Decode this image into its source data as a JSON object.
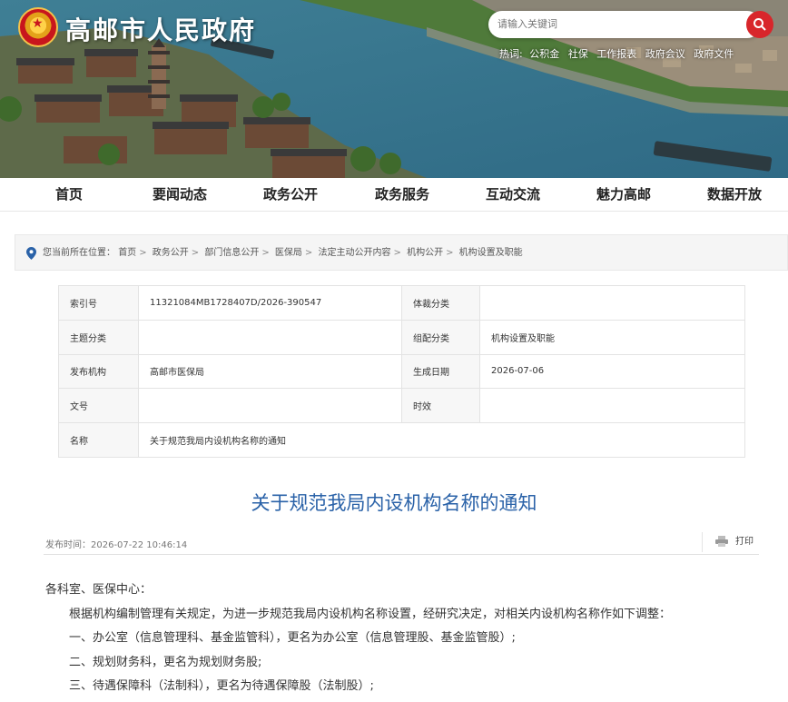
{
  "header": {
    "site_title": "高邮市人民政府",
    "search_placeholder": "请输入关键词",
    "hot_label": "热词:",
    "hot_words": [
      "公积金",
      "社保",
      "工作报表",
      "政府会议",
      "政府文件"
    ]
  },
  "nav": {
    "items": [
      "首页",
      "要闻动态",
      "政务公开",
      "政务服务",
      "互动交流",
      "魅力高邮",
      "数据开放"
    ]
  },
  "breadcrumb": {
    "prefix": "您当前所在位置：",
    "items": [
      "首页",
      "政务公开",
      "部门信息公开",
      "医保局",
      "法定主动公开内容",
      "机构公开",
      "机构设置及职能"
    ]
  },
  "info_table": {
    "rows": [
      {
        "k1": "索引号",
        "v1": "11321084MB1728407D/2026-390547",
        "k2": "体裁分类",
        "v2": ""
      },
      {
        "k1": "主题分类",
        "v1": "",
        "k2": "组配分类",
        "v2": "机构设置及职能"
      },
      {
        "k1": "发布机构",
        "v1": "高邮市医保局",
        "k2": "生成日期",
        "v2": "2026-07-06"
      },
      {
        "k1": "文号",
        "v1": "",
        "k2": "时效",
        "v2": ""
      }
    ],
    "name_label": "名称",
    "name_value": "关于规范我局内设机构名称的通知"
  },
  "article": {
    "title": "关于规范我局内设机构名称的通知",
    "publish_label": "发布时间：",
    "publish_time": "2026-07-22 10:46:14",
    "print_label": "打印",
    "salutation": "各科室、医保中心：",
    "paragraphs": [
      "根据机构编制管理有关规定，为进一步规范我局内设机构名称设置，经研究决定，对相关内设机构名称作如下调整：",
      "一、办公室（信息管理科、基金监管科），更名为办公室（信息管理股、基金监管股）;",
      "二、规划财务科，更名为规划财务股;",
      "三、待遇保障科（法制科），更名为待遇保障股（法制股）;"
    ]
  },
  "colors": {
    "accent_red": "#d8262b",
    "title_blue": "#2a62a8"
  }
}
